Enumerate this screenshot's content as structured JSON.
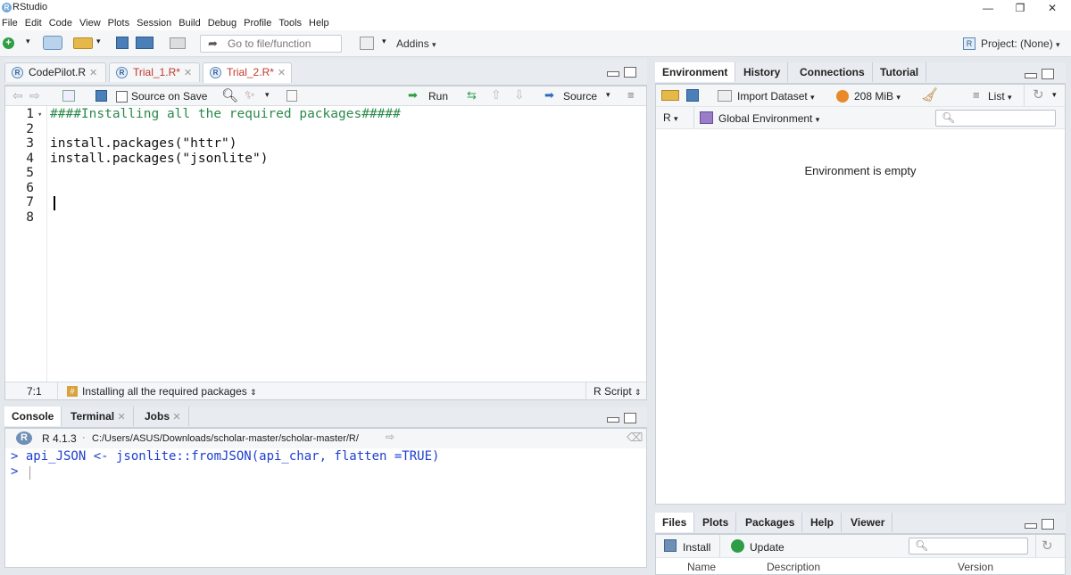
{
  "window": {
    "title": "RStudio",
    "controls": [
      "—",
      "❐",
      "✕"
    ]
  },
  "menu": [
    "File",
    "Edit",
    "Code",
    "View",
    "Plots",
    "Session",
    "Build",
    "Debug",
    "Profile",
    "Tools",
    "Help"
  ],
  "toolbar": {
    "goto_placeholder": "Go to file/function",
    "addins_label": "Addins",
    "project_label": "Project: (None)"
  },
  "editor": {
    "tabs": [
      {
        "label": "CodePilot.R",
        "modified": false
      },
      {
        "label": "Trial_1.R*",
        "modified": true
      },
      {
        "label": "Trial_2.R*",
        "modified": true
      }
    ],
    "source_on_save_label": "Source on Save",
    "run_label": "Run",
    "source_label": "Source",
    "lines": [
      {
        "num": "1",
        "text": "####Installing all the required packages#####"
      },
      {
        "num": "2",
        "text": ""
      },
      {
        "num": "3",
        "text": "install.packages(\"httr\")"
      },
      {
        "num": "4",
        "text": "install.packages(\"jsonlite\")"
      },
      {
        "num": "5",
        "text": ""
      },
      {
        "num": "6",
        "text": ""
      },
      {
        "num": "7",
        "text": ""
      },
      {
        "num": "8",
        "text": ""
      }
    ],
    "status": {
      "position": "7:1",
      "section": "Installing all the required packages",
      "filetype": "R Script"
    }
  },
  "console": {
    "tabs": [
      "Console",
      "Terminal",
      "Jobs"
    ],
    "r_version": "R 4.1.3",
    "path": "C:/Users/ASUS/Downloads/scholar-master/scholar-master/R/",
    "lines": [
      "> api_JSON <- jsonlite::fromJSON(api_char, flatten =TRUE)",
      "> "
    ]
  },
  "environment": {
    "tabs": [
      "Environment",
      "History",
      "Connections",
      "Tutorial"
    ],
    "import_label": "Import Dataset",
    "memory_label": "208 MiB",
    "list_label": "List",
    "lang_label": "R",
    "scope_label": "Global Environment",
    "empty_message": "Environment is empty"
  },
  "files": {
    "tabs": [
      "Files",
      "Plots",
      "Packages",
      "Help",
      "Viewer"
    ],
    "install_label": "Install",
    "update_label": "Update",
    "columns": [
      "Name",
      "Description",
      "Version"
    ]
  }
}
